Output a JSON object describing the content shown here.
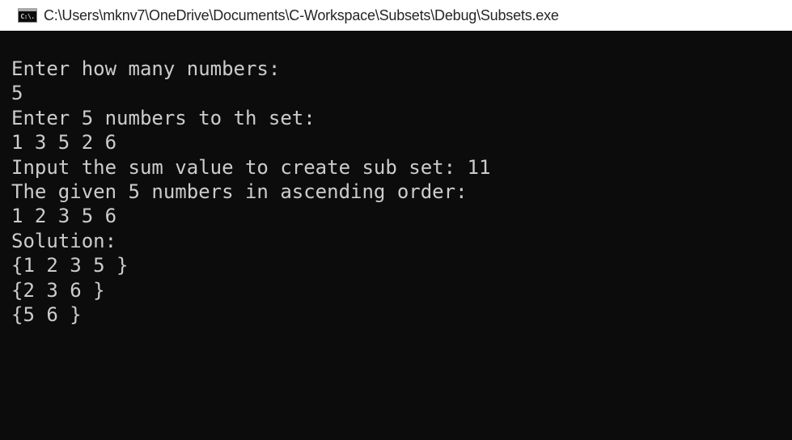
{
  "window": {
    "title": "C:\\Users\\mknv7\\OneDrive\\Documents\\C-Workspace\\Subsets\\Debug\\Subsets.exe",
    "icon": "console-window-icon",
    "icon_text": "C:\\."
  },
  "console": {
    "lines": [
      "Enter how many numbers:",
      "5",
      "Enter 5 numbers to th set:",
      "1 3 5 2 6",
      "Input the sum value to create sub set: 11",
      "The given 5 numbers in ascending order:",
      "1 2 3 5 6",
      "Solution:",
      "{1 2 3 5 }",
      "{2 3 6 }",
      "{5 6 }"
    ],
    "text_color": "#cccccc",
    "background": "#0c0c0c"
  }
}
